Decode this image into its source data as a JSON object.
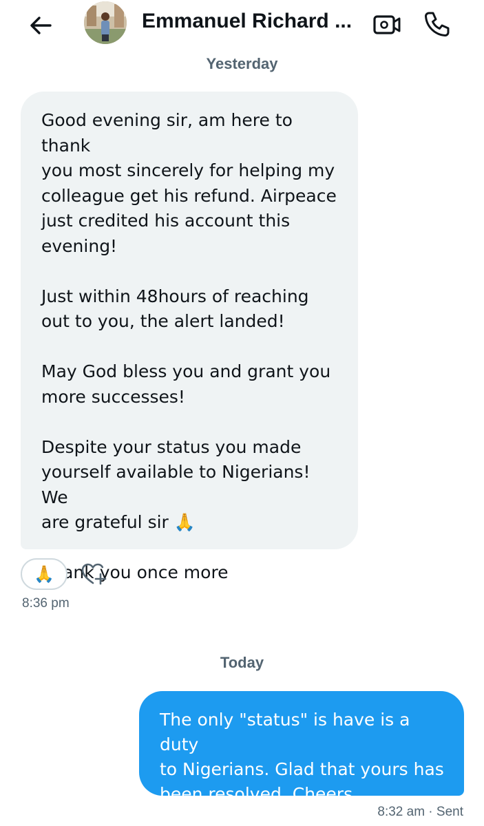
{
  "header": {
    "contact_name": "Emmanuel Richard ...",
    "back_icon": "arrow-left-icon",
    "video_icon": "video-call-icon",
    "call_icon": "phone-icon"
  },
  "conversation": {
    "day_1_label": "Yesterday",
    "incoming_message": {
      "text": "Good evening sir, am here to thank\nyou most sincerely for helping my\ncolleague get his refund. Airpeace\njust credited his account this\nevening!\n\nJust within 48hours of reaching\nout to you, the alert landed!\n\nMay God bless you and grant you\nmore successes!\n\nDespite your status you made\nyourself available to Nigerians! We\nare grateful sir 🙏\n\nThank you once more",
      "reaction": "🙏",
      "time": "8:36 pm"
    },
    "day_2_label": "Today",
    "outgoing_message": {
      "text": "The only \"status\" is have is a duty\nto Nigerians. Glad that yours has\nbeen resolved. Cheers.",
      "status": "8:32 am · Sent"
    }
  },
  "colors": {
    "accent": "#1d9bf0",
    "incoming_bubble": "#eff3f4",
    "secondary_text": "#536471"
  }
}
